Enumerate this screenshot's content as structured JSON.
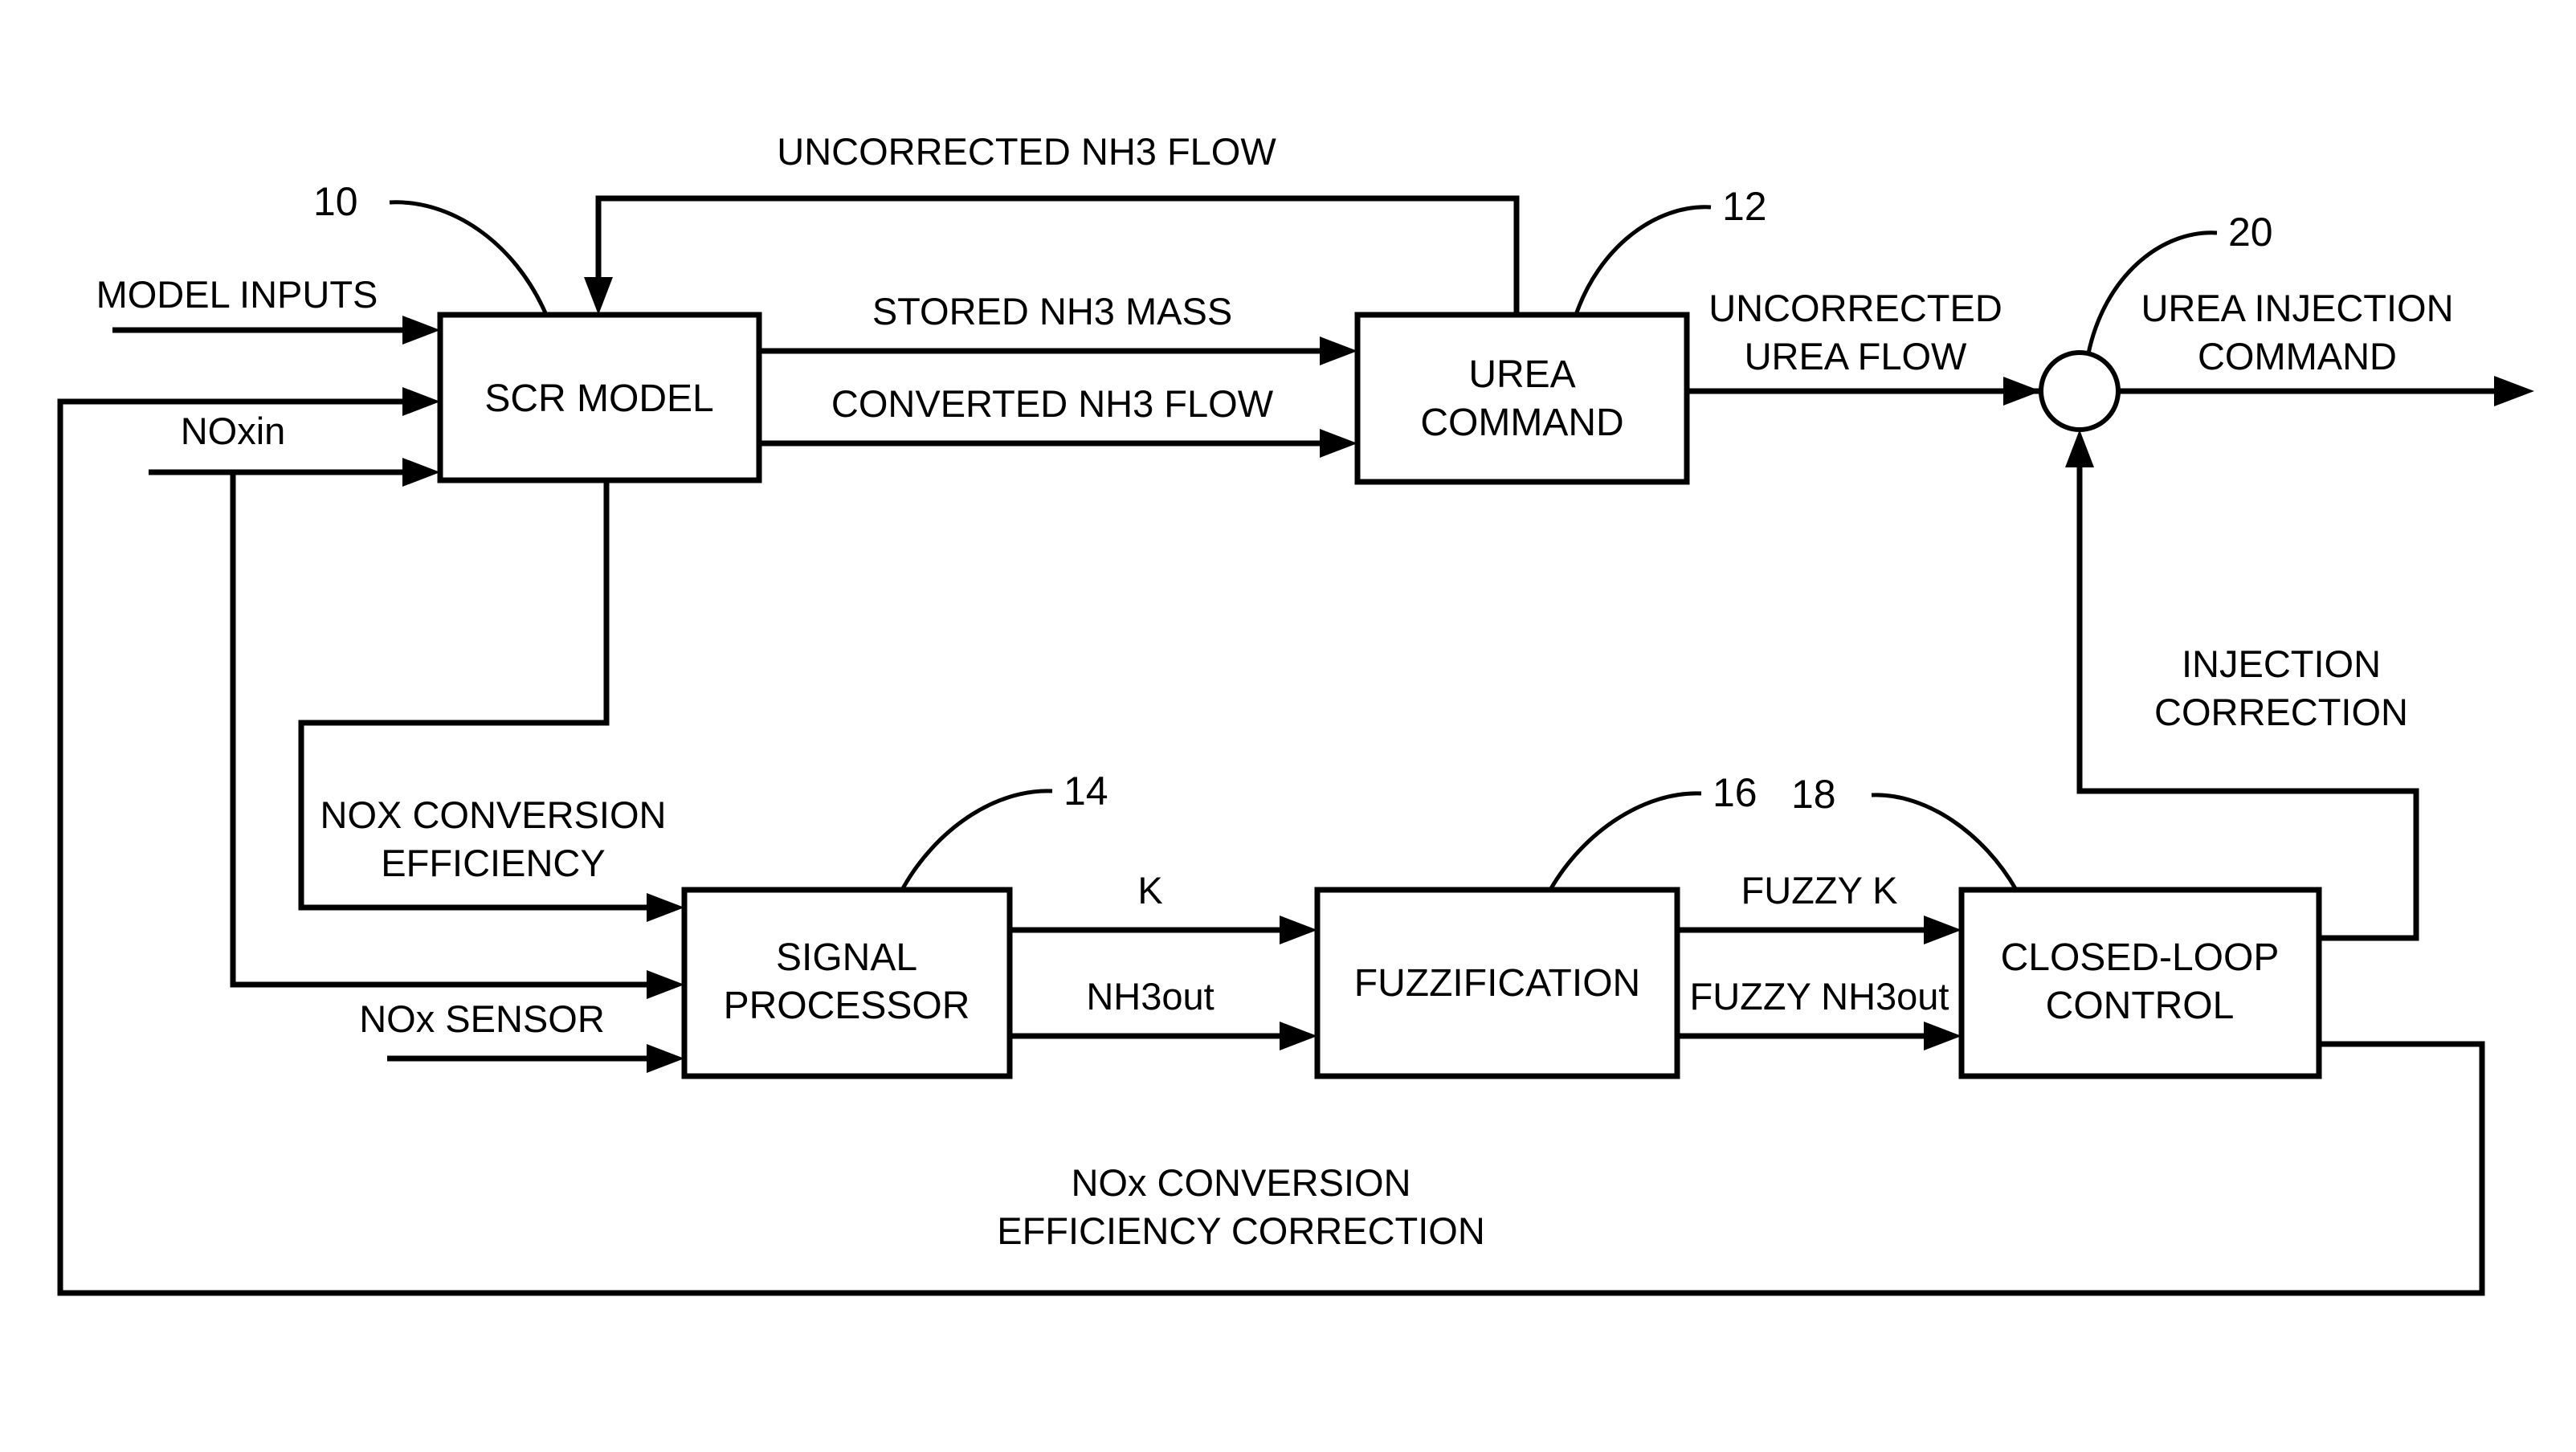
{
  "figure": {
    "type": "block-diagram",
    "title": "SCR urea injection fuzzy closed-loop control block diagram",
    "background_color": "#ffffff",
    "line_color": "#000000"
  },
  "blocks": [
    {
      "id": "scr_model",
      "label_line1": "SCR MODEL",
      "label_line2": "",
      "ref": "10"
    },
    {
      "id": "urea_command",
      "label_line1": "UREA",
      "label_line2": "COMMAND",
      "ref": "12"
    },
    {
      "id": "signal_proc",
      "label_line1": "SIGNAL",
      "label_line2": "PROCESSOR",
      "ref": "14"
    },
    {
      "id": "fuzzification",
      "label_line1": "FUZZIFICATION",
      "label_line2": "",
      "ref": "16"
    },
    {
      "id": "closed_loop",
      "label_line1": "CLOSED-LOOP",
      "label_line2": "CONTROL",
      "ref": "18"
    },
    {
      "id": "summing",
      "label_line1": "",
      "label_line2": "",
      "ref": "20"
    }
  ],
  "refs": {
    "scr_model": "10",
    "urea_command": "12",
    "signal_processor": "14",
    "fuzzification": "16",
    "closed_loop_control": "18",
    "summing_junction": "20"
  },
  "signals": {
    "uncorrected_nh3_flow": "UNCORRECTED NH3 FLOW",
    "model_inputs": "MODEL INPUTS",
    "noxin": "NOxin",
    "stored_nh3_mass": "STORED NH3 MASS",
    "converted_nh3_flow": "CONVERTED NH3 FLOW",
    "uncorrected_urea_flow_l1": "UNCORRECTED",
    "uncorrected_urea_flow_l2": "UREA FLOW",
    "urea_injection_command_l1": "UREA INJECTION",
    "urea_injection_command_l2": "COMMAND",
    "injection_correction_l1": "INJECTION",
    "injection_correction_l2": "CORRECTION",
    "nox_conversion_efficiency_l1": "NOX CONVERSION",
    "nox_conversion_efficiency_l2": "EFFICIENCY",
    "nox_sensor": "NOx SENSOR",
    "k": "K",
    "nh3out": "NH3out",
    "fuzzy_k": "FUZZY K",
    "fuzzy_nh3out": "FUZZY NH3out",
    "nox_conversion_efficiency_correction_l1": "NOx CONVERSION",
    "nox_conversion_efficiency_correction_l2": "EFFICIENCY CORRECTION"
  },
  "block_labels": {
    "scr_model": "SCR MODEL",
    "urea_command_l1": "UREA",
    "urea_command_l2": "COMMAND",
    "signal_processor_l1": "SIGNAL",
    "signal_processor_l2": "PROCESSOR",
    "fuzzification": "FUZZIFICATION",
    "closed_loop_l1": "CLOSED-LOOP",
    "closed_loop_l2": "CONTROL"
  }
}
